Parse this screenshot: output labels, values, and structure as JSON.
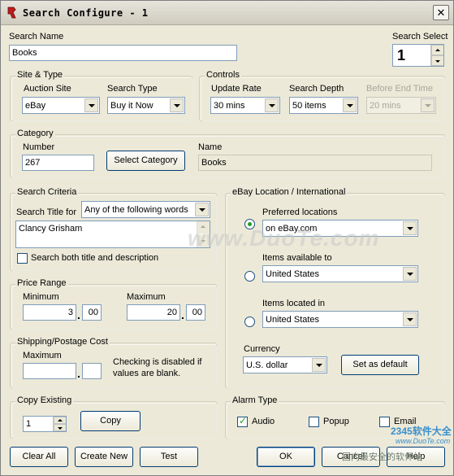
{
  "window": {
    "title": "Search Configure - 1"
  },
  "search_name": {
    "label": "Search Name",
    "value": "Books"
  },
  "search_select": {
    "label": "Search Select",
    "value": "1"
  },
  "site_type": {
    "legend": "Site & Type",
    "auction_site_label": "Auction Site",
    "auction_site_value": "eBay",
    "search_type_label": "Search Type",
    "search_type_value": "Buy it Now"
  },
  "controls": {
    "legend": "Controls",
    "update_rate_label": "Update Rate",
    "update_rate_value": "30 mins",
    "search_depth_label": "Search Depth",
    "search_depth_value": "50 items",
    "before_end_label": "Before End Time",
    "before_end_value": "20 mins"
  },
  "category": {
    "legend": "Category",
    "number_label": "Number",
    "number_value": "267",
    "select_button": "Select Category",
    "name_label": "Name",
    "name_value": "Books"
  },
  "search_criteria": {
    "legend": "Search Criteria",
    "title_for_label": "Search Title for",
    "match_value": "Any of the following words",
    "terms": "Clancy Grisham",
    "both_label": "Search both title and description"
  },
  "price_range": {
    "legend": "Price Range",
    "min_label": "Minimum",
    "min_whole": "3",
    "min_cents": "00",
    "max_label": "Maximum",
    "max_whole": "20",
    "max_cents": "00"
  },
  "shipping": {
    "legend": "Shipping/Postage Cost",
    "max_label": "Maximum",
    "whole": "",
    "cents": "",
    "note": "Checking is disabled if values are blank."
  },
  "copy_existing": {
    "legend": "Copy Existing",
    "value": "1",
    "copy_button": "Copy"
  },
  "location": {
    "legend": "eBay Location / International",
    "preferred_label": "Preferred locations",
    "preferred_value": "on eBay.com",
    "available_label": "Items available to",
    "available_value": "United States",
    "located_label": "Items located in",
    "located_value": "United States",
    "currency_label": "Currency",
    "currency_value": "U.S. dollar",
    "default_button": "Set as default"
  },
  "alarm": {
    "legend": "Alarm Type",
    "audio": "Audio",
    "popup": "Popup",
    "email": "Email"
  },
  "footer": {
    "clear_all": "Clear All",
    "create_new": "Create New",
    "test": "Test",
    "ok": "OK",
    "cancel": "Cancel",
    "help": "Help"
  },
  "watermark": {
    "main": "www.DuoTe.com",
    "brand": "2345软件大全",
    "brand_url": "www.DuoTe.com",
    "safe": "国内最安全的软件站"
  }
}
